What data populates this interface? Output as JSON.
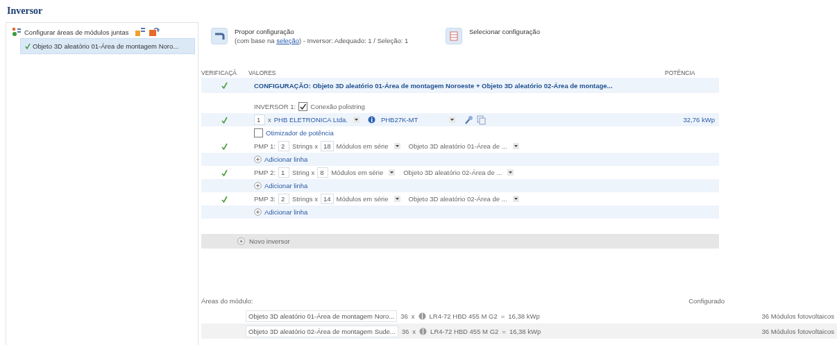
{
  "page_title": "Inversor",
  "tree": {
    "root": {
      "label": "Configurar áreas de módulos juntas"
    },
    "children": [
      {
        "label": "Objeto 3D aleatório 01-Área de montagem Noro...",
        "checked": true,
        "selected": true
      }
    ]
  },
  "actions": [
    {
      "label": "Propor configuração",
      "note_before": "(com base na ",
      "link": "seleção",
      "note_after": ") - Inversor: Adequado: 1 / Seleção: 1"
    },
    {
      "label": "Selecionar configuração"
    }
  ],
  "table": {
    "columns": [
      "VERIFICAÇÃ",
      "VALORES",
      "POTÊNCIA"
    ],
    "configuration": {
      "valid": true,
      "label": "CONFIGURAÇÃO: Objeto 3D aleatório 01-Área de montagem Noroeste + Objeto 3D aleatório 02-Área de montage..."
    },
    "inverters": [
      {
        "label": "INVERSOR 1:",
        "polystring": {
          "label": "Conexão polistring",
          "checked": true
        },
        "valid": true,
        "count": "1",
        "times": "x",
        "manufacturer": "PHB ELETRONICA Ltda.",
        "model": "PHB27K-MT",
        "power": "32,76 kWp",
        "optimizer": {
          "label": "Otimizador de potência",
          "checked": false
        },
        "mppts": [
          {
            "valid": true,
            "label": "PMP 1:",
            "strings": "2",
            "strings_label": "Strings x",
            "modules": "18",
            "modules_label": "Módulos em série",
            "area": "Objeto 3D aleatório 01-Área de ...",
            "add_label": "Adicionar linha"
          },
          {
            "valid": true,
            "label": "PMP 2:",
            "strings": "1",
            "strings_label": "String x",
            "modules": "8",
            "modules_label": "Módulos em série",
            "area": "Objeto 3D aleatório 02-Área de ...",
            "add_label": "Adicionar linha"
          },
          {
            "valid": true,
            "label": "PMP 3:",
            "strings": "2",
            "strings_label": "Strings x",
            "modules": "14",
            "modules_label": "Módulos em série",
            "area": "Objeto 3D aleatório 02-Área de ...",
            "add_label": "Adicionar linha"
          }
        ]
      }
    ],
    "new_inverter": "Novo inversor"
  },
  "module_areas": {
    "label": "Áreas do módulo:",
    "configured_label": "Configurado",
    "rows": [
      {
        "area": "Objeto 3D aleatório 01-Área de montagem Noro...",
        "count": "36",
        "times": "x",
        "module": "LR4-72 HBD 455 M G2",
        "equals": "=",
        "power": "16,38 kWp",
        "configured": "36 Módulos fotovoltaicos"
      },
      {
        "area": "Objeto 3D aleatório 02-Área de montagem Sude...",
        "count": "36",
        "times": "x",
        "module": "LR4-72 HBD 455 M G2",
        "equals": "=",
        "power": "16,38 kWp",
        "configured": "36 Módulos fotovoltaicos"
      }
    ]
  }
}
